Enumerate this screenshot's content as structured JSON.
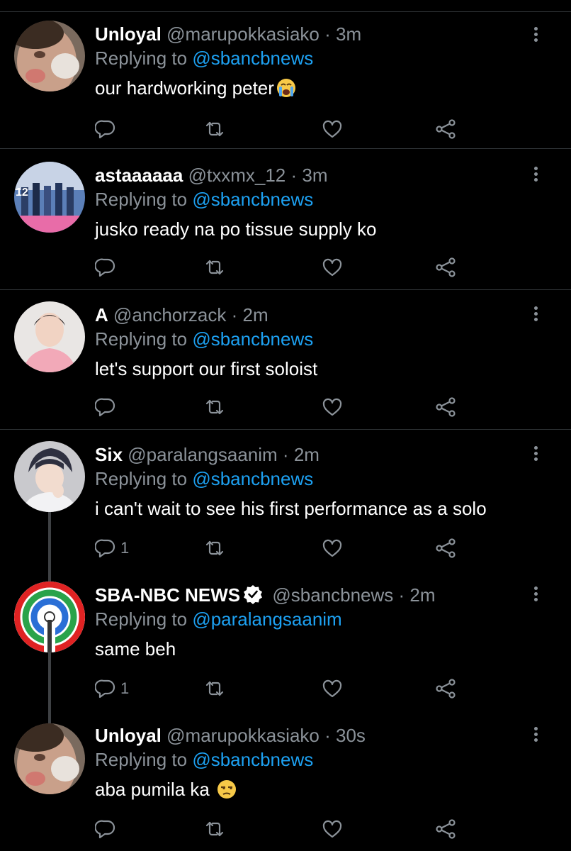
{
  "tweets": [
    {
      "name": "Unloyal",
      "handle": "@marupokkasiako",
      "time": "3m",
      "replying_label": "Replying to",
      "replying_to": "@sbancbnews",
      "text": "our hardworking peter",
      "emoji": "crying-face",
      "reply_count": ""
    },
    {
      "name": "astaaaaaa",
      "handle": "@txxmx_12",
      "time": "3m",
      "replying_label": "Replying to",
      "replying_to": "@sbancbnews",
      "text": "jusko ready na po tissue supply ko",
      "reply_count": ""
    },
    {
      "name": "A",
      "handle": "@anchorzack",
      "time": "2m",
      "replying_label": "Replying to",
      "replying_to": "@sbancbnews",
      "text": "let's support our first soloist",
      "reply_count": ""
    },
    {
      "name": "Six",
      "handle": "@paralangsaanim",
      "time": "2m",
      "replying_label": "Replying to",
      "replying_to": "@sbancbnews",
      "text": "i can't wait to see his first performance as a solo",
      "reply_count": "1"
    },
    {
      "name": "SBA-NBC NEWS",
      "handle": "@sbancbnews",
      "time": "2m",
      "replying_label": "Replying to",
      "replying_to": "@paralangsaanim",
      "text": "same beh",
      "reply_count": "1",
      "verified": true
    },
    {
      "name": "Unloyal",
      "handle": "@marupokkasiako",
      "time": "30s",
      "replying_label": "Replying to",
      "replying_to": "@sbancbnews",
      "text": "aba pumila ka",
      "emoji": "unamused-face",
      "reply_count": ""
    }
  ],
  "separator": "·",
  "colors": {
    "background": "#000000",
    "accent": "#1da1f2",
    "muted": "#8b9299",
    "divider": "#2f3336"
  },
  "icons": [
    "reply-icon",
    "retweet-icon",
    "like-icon",
    "share-icon",
    "more-icon",
    "verified-icon"
  ]
}
